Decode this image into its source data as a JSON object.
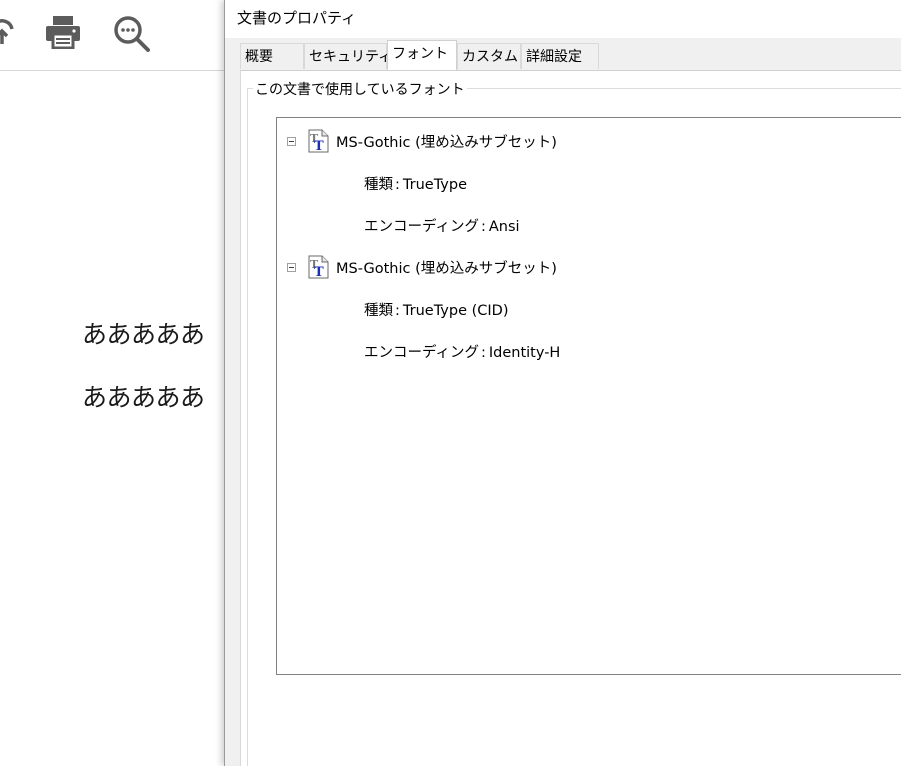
{
  "viewer": {
    "toolbar_icons": [
      "cloud-upload-icon",
      "print-icon",
      "zoom-icon"
    ],
    "document_lines": [
      "あああああ",
      "あああああ"
    ]
  },
  "dialog": {
    "title": "文書のプロパティ",
    "tabs": [
      {
        "label": "概要",
        "active": false
      },
      {
        "label": "セキュリティ",
        "active": false
      },
      {
        "label": "フォント",
        "active": true
      },
      {
        "label": "カスタム",
        "active": false
      },
      {
        "label": "詳細設定",
        "active": false
      }
    ],
    "group_label": "この文書で使用しているフォント",
    "fonts": [
      {
        "name": "MS-Gothic (埋め込みサブセット)",
        "type_label": "種類",
        "type_value": "TrueType",
        "encoding_label": "エンコーディング",
        "encoding_value": "Ansi",
        "icon": "truetype-font-icon",
        "expanded": true
      },
      {
        "name": "MS-Gothic (埋め込みサブセット)",
        "type_label": "種類",
        "type_value": "TrueType (CID)",
        "encoding_label": "エンコーディング",
        "encoding_value": "Identity-H",
        "icon": "truetype-font-icon",
        "expanded": true
      }
    ],
    "separator": ":"
  },
  "colors": {
    "dialog_bg": "#f0f0f0",
    "tab_page_bg": "#ffffff",
    "tree_border": "#828282",
    "icon_gray": "#5c5c5c",
    "font_icon_blue": "#1d2fb8"
  }
}
